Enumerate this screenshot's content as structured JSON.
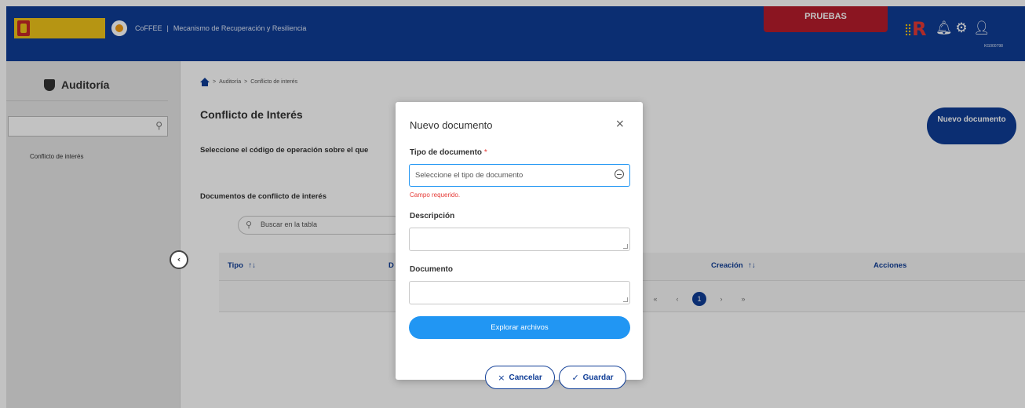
{
  "header": {
    "app_name": "CoFFEE",
    "separator": "|",
    "app_subtitle": "Mecanismo de Recuperación y Resiliencia",
    "environment_badge": "PRUEBAS",
    "user_code": "KG000798",
    "brand_color": "#0f3d96",
    "badge_color": "#b71c2c"
  },
  "sidebar": {
    "title": "Auditoría",
    "items": [
      {
        "label": "Conflicto de interés"
      }
    ],
    "collapse_icon": "‹"
  },
  "main": {
    "breadcrumb": {
      "sep": ">",
      "items": [
        "Auditoría",
        "Conflicto de interés"
      ]
    },
    "page_title": "Conflicto de Interés",
    "new_document_button": "Nuevo documento",
    "operation_label": "Seleccione el código de operación sobre el que",
    "documents_title": "Documentos de conflicto de interés",
    "search_placeholder": "Buscar en la tabla",
    "table": {
      "columns": [
        {
          "label": "Tipo",
          "sort_icon": "↑↓"
        },
        {
          "label": "D",
          "sort_icon": ""
        },
        {
          "label": "Creación",
          "sort_icon": "↑↓"
        },
        {
          "label": "Acciones",
          "sort_icon": ""
        }
      ],
      "pagination": {
        "first": "«",
        "prev": "‹",
        "current": "1",
        "next": "›",
        "last": "»"
      }
    }
  },
  "modal": {
    "title": "Nuevo documento",
    "close_icon": "×",
    "type_label": "Tipo de documento",
    "required_mark": "*",
    "type_placeholder": "Seleccione el tipo de documento",
    "type_error": "Campo requerido.",
    "description_label": "Descripción",
    "document_label": "Documento",
    "browse_button": "Explorar archivos",
    "cancel_button": "Cancelar",
    "save_button": "Guardar",
    "cancel_icon": "×",
    "save_icon": "✓",
    "accent_color": "#2196f3",
    "error_color": "#e53935"
  }
}
